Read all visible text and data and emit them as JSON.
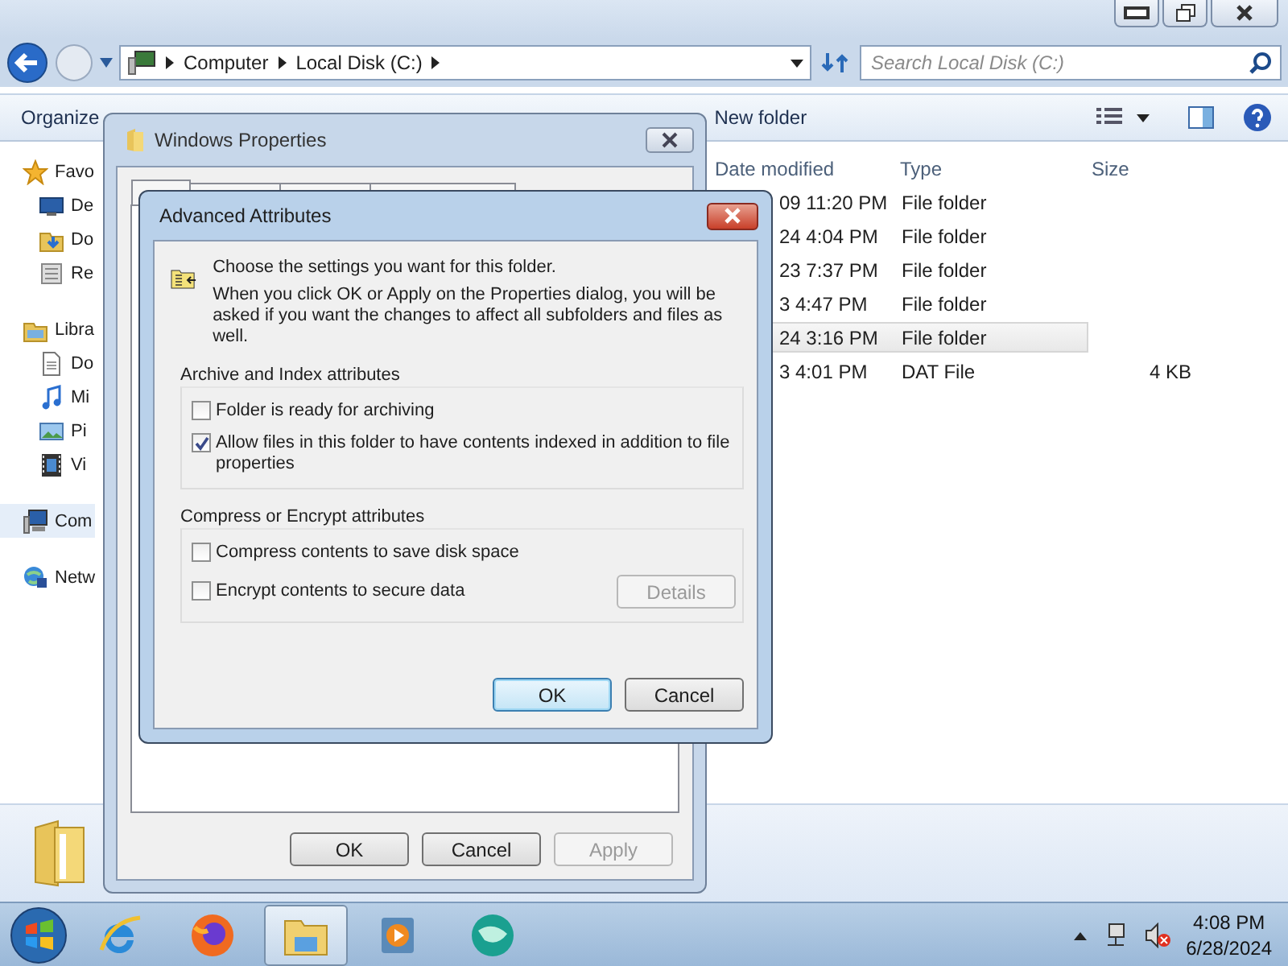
{
  "explorer": {
    "window_buttons": [
      {
        "kind": "minimize"
      },
      {
        "kind": "maximize"
      },
      {
        "kind": "close"
      }
    ],
    "breadcrumb": [
      "Computer",
      "Local Disk (C:)"
    ],
    "search": {
      "placeholder": "Search Local Disk (C:)"
    },
    "toolbar": [
      "Organize",
      "New folder"
    ],
    "sidebar": {
      "items": [
        {
          "label": "Favo",
          "kind": "star",
          "selected": false,
          "children": [
            {
              "label": "De",
              "kind": "desktop",
              "selected": false
            },
            {
              "label": "Do",
              "kind": "downloads",
              "selected": false
            },
            {
              "label": "Re",
              "kind": "recent",
              "selected": false
            }
          ]
        },
        {
          "label": "Libra",
          "kind": "library",
          "selected": false,
          "children": [
            {
              "label": "Do",
              "kind": "document",
              "selected": false
            },
            {
              "label": "Mi",
              "kind": "music",
              "selected": false
            },
            {
              "label": "Pi",
              "kind": "picture",
              "selected": false
            },
            {
              "label": "Vi",
              "kind": "video",
              "selected": false
            }
          ]
        },
        {
          "label": "Com",
          "kind": "computer",
          "selected": true
        },
        {
          "label": "Netw",
          "kind": "network",
          "selected": false
        }
      ]
    },
    "columns": [
      "Date modified",
      "Type",
      "Size"
    ],
    "rows": [
      {
        "date_modified": "09 11:20 PM",
        "type": "File folder",
        "selected": false
      },
      {
        "date_modified": "24 4:04 PM",
        "type": "File folder",
        "selected": false
      },
      {
        "date_modified": "23 7:37 PM",
        "type": "File folder",
        "selected": false
      },
      {
        "date_modified": "3 4:47 PM",
        "type": "File folder",
        "selected": false
      },
      {
        "date_modified": "24 3:16 PM",
        "type": "File folder",
        "selected": true
      },
      {
        "date_modified": "3 4:01 PM",
        "type": "DAT File",
        "size": "4 KB",
        "selected": false
      }
    ]
  },
  "properties_dialog": {
    "title": "Windows Properties",
    "buttons": [
      {
        "label": "OK",
        "disabled": false
      },
      {
        "label": "Cancel",
        "disabled": false
      },
      {
        "label": "Apply",
        "disabled": true
      }
    ]
  },
  "advanced_attributes": {
    "title": "Advanced Attributes",
    "heading": "Choose the settings you want for this folder.",
    "description": "When you click OK or Apply on the Properties dialog, you will be asked if you want the changes to affect all subfolders and files as well.",
    "groups": [
      {
        "title": "Archive and Index attributes",
        "options": [
          {
            "label": "Folder is ready for archiving",
            "checked": false
          },
          {
            "label": "Allow files in this folder to have contents indexed in addition to file properties",
            "checked": true
          }
        ]
      },
      {
        "title": "Compress or Encrypt attributes",
        "options": [
          {
            "label": "Compress contents to save disk space",
            "checked": false
          },
          {
            "label": "Encrypt contents to secure data",
            "checked": false
          }
        ],
        "button": {
          "label": "Details",
          "disabled": true
        }
      }
    ],
    "buttons": [
      {
        "label": "OK",
        "default": true
      },
      {
        "label": "Cancel",
        "default": false
      }
    ]
  },
  "taskbar": {
    "apps": [
      {
        "kind": "ie",
        "active": false
      },
      {
        "kind": "firefox",
        "active": false
      },
      {
        "kind": "explorer",
        "active": true
      },
      {
        "kind": "media",
        "active": false
      },
      {
        "kind": "globe",
        "active": false
      }
    ],
    "tray": [
      {
        "kind": "arrow"
      },
      {
        "kind": "network"
      },
      {
        "kind": "volume-muted"
      }
    ],
    "clock": {
      "time": "4:08 PM",
      "date": "6/28/2024"
    }
  }
}
